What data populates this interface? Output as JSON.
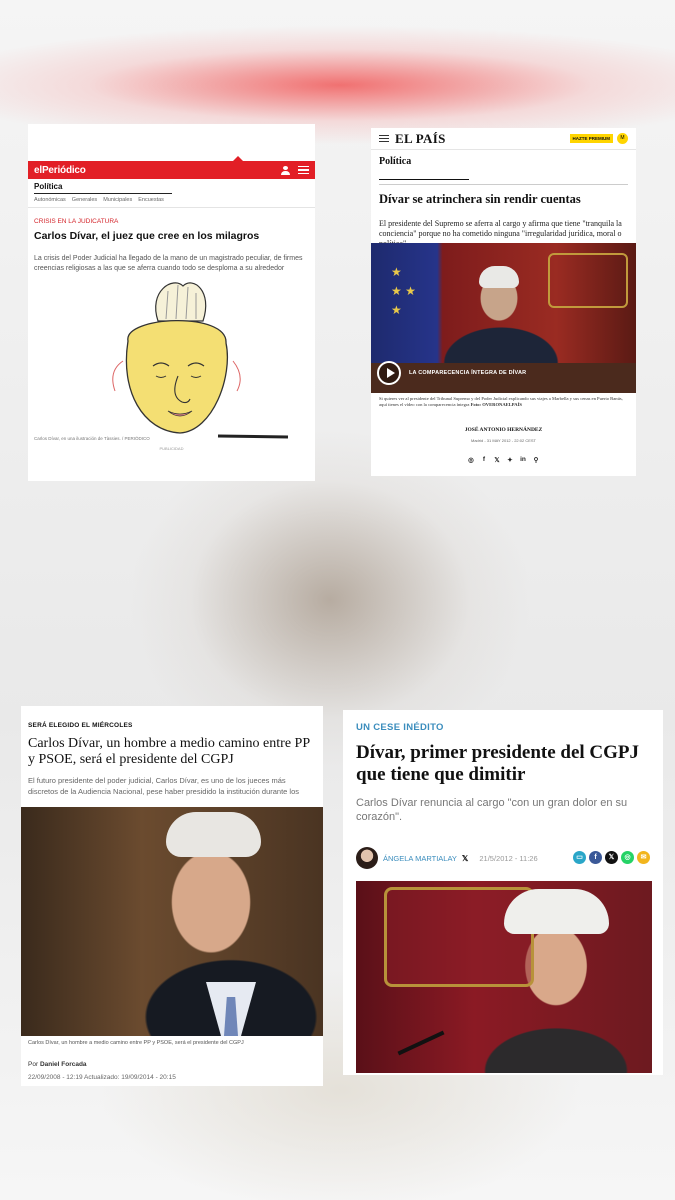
{
  "card1": {
    "logo": "elPeriódico",
    "section": "Política",
    "subnav": [
      "Autonómicas",
      "Generales",
      "Municipales",
      "Encuestas"
    ],
    "kicker": "CRISIS EN LA JUDICATURA",
    "headline": "Carlos Dívar, el juez que cree en los milagros",
    "lead": "La crisis del Poder Judicial ha llegado de la mano de un magistrado peculiar, de firmes creencias religiosas a las que se aferra cuando todo se desploma a su alrededor",
    "caption": "Carlos Dívar, en una ilustración de Tàssies. / PERIÓDICO",
    "pub": "PUBLICIDAD"
  },
  "card2": {
    "logo": "EL PAÍS",
    "premium": "HAZTE PREMIUM",
    "user": "M",
    "section": "Política",
    "headline": "Dívar se atrinchera sin rendir cuentas",
    "lead": "El presidente del Supremo se aferra al cargo y afirma que tiene \"tranquila la conciencia\" porque no ha cometido ninguna \"irregularidad jurídica, moral o política\"",
    "video_label": "LA COMPARECENCIA ÍNTEGRA DE DÍVAR",
    "caption": "Si quieres ver al presidente del Tribunal Supremo y del Poder Judicial explicando sus viajes a Marbella y sus cenas en Puerto Banús, aquí tienes el vídeo con la comparecencia íntegra",
    "credit": "Foto: OVERONAELPAÍS",
    "author": "JOSÉ ANTONIO HERNÁNDEZ",
    "date": "Madrid - 31 MAY 2012 - 22:02 CEST",
    "share_icons": [
      "whatsapp-icon",
      "facebook-icon",
      "x-icon",
      "bluesky-icon",
      "linkedin-icon",
      "link-icon"
    ],
    "share_glyphs": [
      "◎",
      "f",
      "𝕏",
      "✦",
      "in",
      "⚲"
    ]
  },
  "card3": {
    "kicker": "SERÁ ELEGIDO EL MIÉRCOLES",
    "headline": "Carlos Dívar, un hombre a medio camino entre PP y PSOE, será el presidente del CGPJ",
    "lead": "El futuro presidente del poder judicial, Carlos Dívar, es uno de los jueces más discretos de la Audiencia Nacional, pese haber presidido la institución durante los",
    "caption": "Carlos Dívar, un hombre a medio camino entre PP y PSOE, será el presidente del CGPJ",
    "author_prefix": "Por",
    "author": "Daniel Forcada",
    "dates": "22/09/2008 - 12:19   Actualizado: 19/09/2014 - 20:15"
  },
  "card4": {
    "kicker": "UN CESE INÉDITO",
    "headline": "Dívar, primer presidente del CGPJ que tiene que dimitir",
    "lead": "Carlos Dívar renuncia al cargo \"con un gran dolor en su corazón\".",
    "author": "ÁNGELA MARTIALAY",
    "x_glyph": "𝕏",
    "date": "21/5/2012 - 11:26",
    "share_icons": [
      {
        "name": "comments-icon",
        "glyph": "▭",
        "color": "#2aa6c8"
      },
      {
        "name": "facebook-icon",
        "glyph": "f",
        "color": "#3b5998"
      },
      {
        "name": "x-icon",
        "glyph": "𝕏",
        "color": "#111111"
      },
      {
        "name": "whatsapp-icon",
        "glyph": "◎",
        "color": "#25d366"
      },
      {
        "name": "email-icon",
        "glyph": "✉",
        "color": "#f2b51d"
      }
    ]
  }
}
